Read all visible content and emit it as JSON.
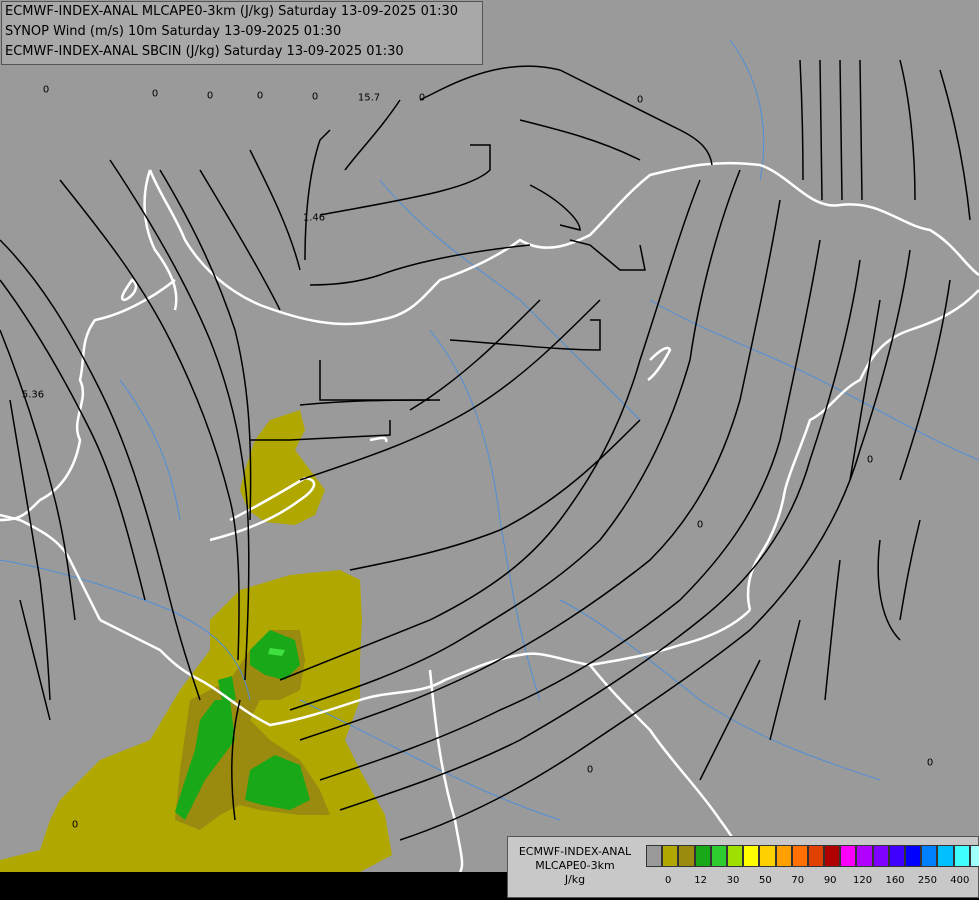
{
  "titles": [
    "ECMWF-INDEX-ANAL MLCAPE0-3km (J/kg) Saturday 13-09-2025 01:30",
    "SYNOP Wind (m/s) 10m Saturday 13-09-2025 01:30",
    "ECMWF-INDEX-ANAL SBCIN (J/kg) Saturday 13-09-2025 01:30"
  ],
  "colors": {
    "background": "#9a9a9a",
    "border": "#ffffff",
    "river": "#4f8fd8",
    "streamline": "#000000",
    "cape_low": "#b0a800",
    "cape_mid": "#9a8a10",
    "cape_high": "#18a818",
    "cape_peak": "#40e040"
  },
  "station_values": [
    {
      "label": "0"
    },
    {
      "label": "0"
    },
    {
      "label": "0"
    },
    {
      "label": "0"
    },
    {
      "label": "0"
    },
    {
      "label": "15.7"
    },
    {
      "label": "0"
    },
    {
      "label": "5.36"
    },
    {
      "label": "1.46"
    },
    {
      "label": "0"
    },
    {
      "label": "0"
    },
    {
      "label": "0"
    },
    {
      "label": "0"
    },
    {
      "label": "0"
    },
    {
      "label": "0"
    }
  ],
  "legend": {
    "name_lines": [
      "ECMWF-INDEX-ANAL",
      "MLCAPE0-3km",
      "J/kg"
    ],
    "swatch_colors": [
      "#9a9a9a",
      "#b0a800",
      "#9a8a10",
      "#18a818",
      "#2ecc2e",
      "#a0e000",
      "#ffff00",
      "#ffd000",
      "#ffa000",
      "#ff7000",
      "#e04000",
      "#b00000",
      "#ff00ff",
      "#b000ff",
      "#8000ff",
      "#4000ff",
      "#0000ff",
      "#0080ff",
      "#00c0ff",
      "#40ffff",
      "#a0ffff",
      "#ffffff"
    ],
    "ticks": [
      "0",
      "12",
      "30",
      "50",
      "70",
      "90",
      "120",
      "160",
      "250",
      "400"
    ]
  }
}
